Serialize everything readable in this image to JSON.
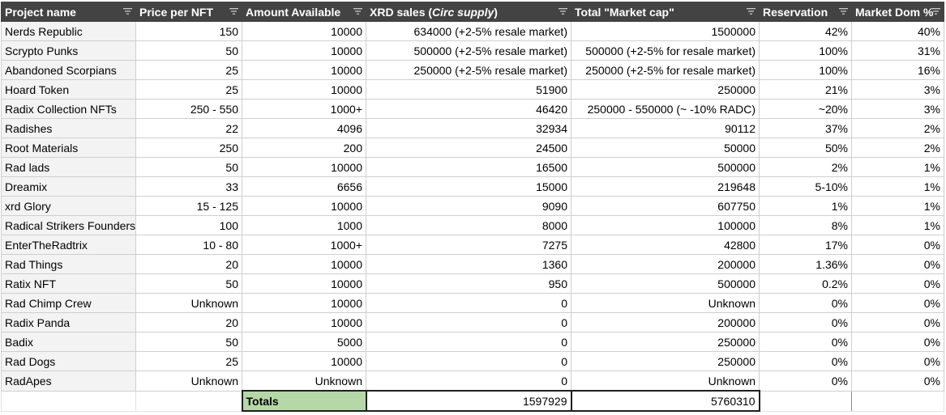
{
  "columns": [
    {
      "label": "Project name",
      "name": "col-project-name"
    },
    {
      "label": "Price per NFT",
      "name": "col-price-per-nft"
    },
    {
      "label": "Amount Available",
      "name": "col-amount-available"
    },
    {
      "label_prefix": "XRD sales (",
      "label_italic": "Circ supply",
      "label_suffix": ")",
      "name": "col-xrd-sales"
    },
    {
      "label": "Total \"Market cap\"",
      "name": "col-total-market-cap"
    },
    {
      "label": "Reservation",
      "name": "col-reservation"
    },
    {
      "label": "Market Dom %",
      "name": "col-market-dom"
    }
  ],
  "rows": [
    {
      "project": "Nerds Republic",
      "price": "150",
      "amount": "10000",
      "sales": "634000 (+2-5% resale market)",
      "mcap": "1500000",
      "reservation": "42%",
      "dom": "40%"
    },
    {
      "project": "Scrypto Punks",
      "price": "50",
      "amount": "10000",
      "sales": "500000 (+2-5% resale market)",
      "mcap": "500000 (+2-5% for resale market)",
      "reservation": "100%",
      "dom": "31%"
    },
    {
      "project": "Abandoned Scorpians",
      "price": "25",
      "amount": "10000",
      "sales": "250000 (+2-5% resale market)",
      "mcap": "250000 (+2-5% for resale market)",
      "reservation": "100%",
      "dom": "16%"
    },
    {
      "project": "Hoard Token",
      "price": "25",
      "amount": "10000",
      "sales": "51900",
      "mcap": "250000",
      "reservation": "21%",
      "dom": "3%"
    },
    {
      "project": "Radix Collection NFTs",
      "price": "250 - 550",
      "amount": "1000+",
      "sales": "46420",
      "mcap": "250000 - 550000 (~ -10% RADC)",
      "reservation": "~20%",
      "dom": "3%"
    },
    {
      "project": "Radishes",
      "price": "22",
      "amount": "4096",
      "sales": "32934",
      "mcap": "90112",
      "reservation": "37%",
      "dom": "2%"
    },
    {
      "project": "Root Materials",
      "price": "250",
      "amount": "200",
      "sales": "24500",
      "mcap": "50000",
      "reservation": "50%",
      "dom": "2%"
    },
    {
      "project": "Rad lads",
      "price": "50",
      "amount": "10000",
      "sales": "16500",
      "mcap": "500000",
      "reservation": "2%",
      "dom": "1%"
    },
    {
      "project": "Dreamix",
      "price": "33",
      "amount": "6656",
      "sales": "15000",
      "mcap": "219648",
      "reservation": "5-10%",
      "dom": "1%"
    },
    {
      "project": "xrd Glory",
      "price": "15 - 125",
      "amount": "10000",
      "sales": "9090",
      "mcap": "607750",
      "reservation": "1%",
      "dom": "1%"
    },
    {
      "project": "Radical Strikers Founders",
      "price": "100",
      "amount": "1000",
      "sales": "8000",
      "mcap": "100000",
      "reservation": "8%",
      "dom": "1%"
    },
    {
      "project": "EnterTheRadtrix",
      "price": "10 - 80",
      "amount": "1000+",
      "sales": "7275",
      "mcap": "42800",
      "reservation": "17%",
      "dom": "0%"
    },
    {
      "project": "Rad Things",
      "price": "20",
      "amount": "10000",
      "sales": "1360",
      "mcap": "200000",
      "reservation": "1.36%",
      "dom": "0%"
    },
    {
      "project": "Ratix NFT",
      "price": "50",
      "amount": "10000",
      "sales": "950",
      "mcap": "500000",
      "reservation": "0.2%",
      "dom": "0%"
    },
    {
      "project": "Rad Chimp Crew",
      "price": "Unknown",
      "amount": "10000",
      "sales": "0",
      "mcap": "Unknown",
      "reservation": "0%",
      "dom": "0%"
    },
    {
      "project": "Radix Panda",
      "price": "20",
      "amount": "10000",
      "sales": "0",
      "mcap": "200000",
      "reservation": "0%",
      "dom": "0%"
    },
    {
      "project": "Badix",
      "price": "50",
      "amount": "5000",
      "sales": "0",
      "mcap": "250000",
      "reservation": "0%",
      "dom": "0%"
    },
    {
      "project": "Rad Dogs",
      "price": "25",
      "amount": "10000",
      "sales": "0",
      "mcap": "250000",
      "reservation": "0%",
      "dom": "0%"
    },
    {
      "project": "RadApes",
      "price": "Unknown",
      "amount": "Unknown",
      "sales": "0",
      "mcap": "Unknown",
      "reservation": "0%",
      "dom": "0%"
    }
  ],
  "totals": {
    "label": "Totals",
    "sales": "1597929",
    "mcap": "5760310"
  },
  "colors": {
    "header_bg": "#434343",
    "header_text": "#ffffff",
    "name_col_bg": "#f3f3f3",
    "totals_label_bg": "#b6d7a8",
    "gridline": "#cfcfcf"
  },
  "icons": {
    "filter": "filter-icon"
  }
}
